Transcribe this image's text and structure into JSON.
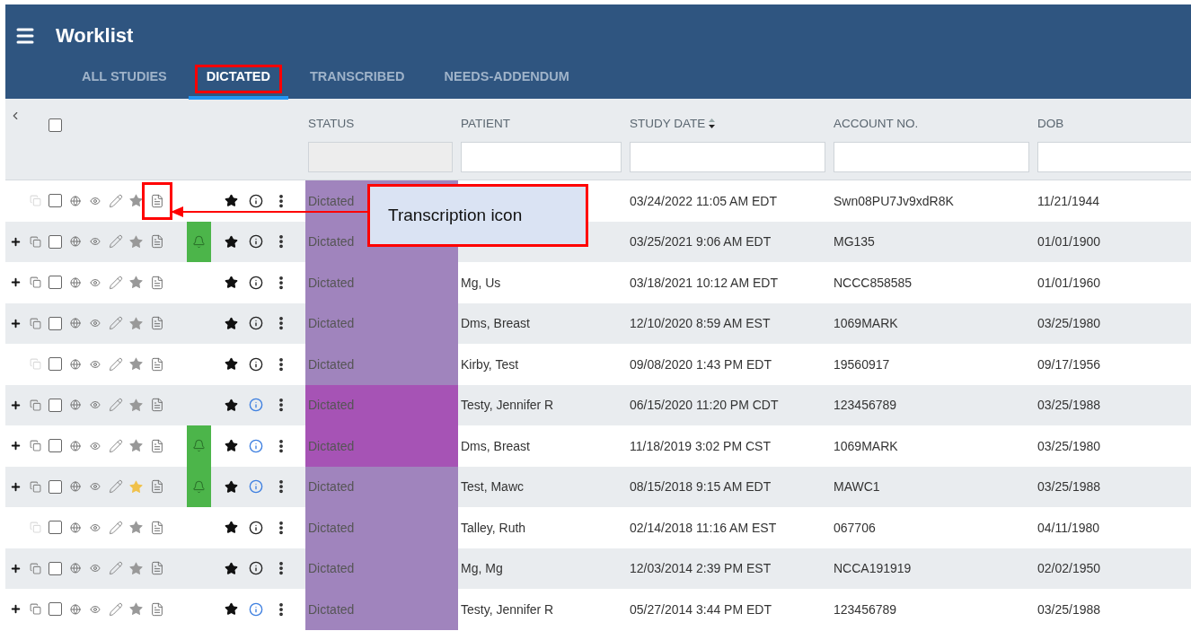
{
  "header": {
    "title": "Worklist"
  },
  "tabs": [
    {
      "label": "ALL STUDIES",
      "selected": false,
      "outlined": false
    },
    {
      "label": "DICTATED",
      "selected": true,
      "outlined": true
    },
    {
      "label": "TRANSCRIBED",
      "selected": false,
      "outlined": false
    },
    {
      "label": "NEEDS-ADDENDUM",
      "selected": false,
      "outlined": false
    }
  ],
  "columns": [
    {
      "label": "STATUS",
      "sortable": false,
      "filter_disabled": true
    },
    {
      "label": "PATIENT",
      "sortable": false,
      "filter_disabled": false
    },
    {
      "label": "STUDY DATE",
      "sortable": true,
      "filter_disabled": false
    },
    {
      "label": "ACCOUNT NO.",
      "sortable": false,
      "filter_disabled": false
    },
    {
      "label": "DOB",
      "sortable": false,
      "filter_disabled": false
    }
  ],
  "select_all": {
    "checked": false
  },
  "rows": [
    {
      "expandable": false,
      "checked": false,
      "starred": false,
      "transcription_outlined": true,
      "alert": false,
      "info_highlighted": false,
      "status": "Dictated",
      "color": "#a084bd",
      "date": "03/24/2022 11:05 AM EDT",
      "account": "Swn08PU7Jv9xdR8K",
      "dob": "11/21/1944"
    },
    {
      "expandable": true,
      "checked": false,
      "starred": false,
      "transcription_outlined": false,
      "alert": true,
      "info_highlighted": false,
      "status": "Dictated",
      "color": "#a084bd",
      "date": "03/25/2021 9:06 AM EDT",
      "account": "MG135",
      "dob": "01/01/1900"
    },
    {
      "expandable": true,
      "checked": false,
      "starred": false,
      "transcription_outlined": false,
      "alert": false,
      "info_highlighted": false,
      "status": "Dictated",
      "color": "#a084bd",
      "patient": "Mg, Us",
      "date": "03/18/2021 10:12 AM EDT",
      "account": "NCCC858585",
      "dob": "01/01/1960"
    },
    {
      "expandable": true,
      "checked": false,
      "starred": false,
      "transcription_outlined": false,
      "alert": false,
      "info_highlighted": false,
      "status": "Dictated",
      "color": "#a084bd",
      "patient": "Dms, Breast",
      "date": "12/10/2020 8:59 AM EST",
      "account": "1069MARK",
      "dob": "03/25/1980"
    },
    {
      "expandable": false,
      "checked": false,
      "starred": false,
      "transcription_outlined": false,
      "alert": false,
      "info_highlighted": false,
      "status": "Dictated",
      "color": "#a084bd",
      "patient": "Kirby, Test",
      "date": "09/08/2020 1:43 PM EDT",
      "account": "19560917",
      "dob": "09/17/1956"
    },
    {
      "expandable": true,
      "checked": false,
      "starred": false,
      "transcription_outlined": false,
      "alert": false,
      "info_highlighted": true,
      "status": "Dictated",
      "color": "#a653b5",
      "patient": "Testy, Jennifer R",
      "date": "06/15/2020 11:20 PM CDT",
      "account": "123456789",
      "dob": "03/25/1988"
    },
    {
      "expandable": true,
      "checked": false,
      "starred": false,
      "transcription_outlined": false,
      "alert": true,
      "info_highlighted": true,
      "status": "Dictated",
      "color": "#a653b5",
      "patient": "Dms, Breast",
      "date": "11/18/2019 3:02 PM CST",
      "account": "1069MARK",
      "dob": "03/25/1980"
    },
    {
      "expandable": true,
      "checked": false,
      "starred": true,
      "transcription_outlined": false,
      "alert": true,
      "info_highlighted": true,
      "status": "Dictated",
      "color": "#a084bd",
      "patient": "Test, Mawc",
      "date": "08/15/2018 9:15 AM EDT",
      "account": "MAWC1",
      "dob": "03/25/1988"
    },
    {
      "expandable": false,
      "checked": false,
      "starred": false,
      "transcription_outlined": false,
      "alert": false,
      "info_highlighted": false,
      "status": "Dictated",
      "color": "#a084bd",
      "patient": "Talley, Ruth",
      "date": "02/14/2018 11:16 AM EST",
      "account": "067706",
      "dob": "04/11/1980"
    },
    {
      "expandable": true,
      "checked": false,
      "starred": false,
      "transcription_outlined": false,
      "alert": false,
      "info_highlighted": false,
      "status": "Dictated",
      "color": "#a084bd",
      "patient": "Mg, Mg",
      "date": "12/03/2014 2:39 PM EST",
      "account": "NCCA191919",
      "dob": "02/02/1950"
    },
    {
      "expandable": true,
      "checked": false,
      "starred": false,
      "transcription_outlined": false,
      "alert": false,
      "info_highlighted": true,
      "status": "Dictated",
      "color": "#a084bd",
      "patient": "Testy, Jennifer R",
      "date": "05/27/2014 3:44 PM EDT",
      "account": "123456789",
      "dob": "03/25/1988"
    }
  ],
  "annotation": {
    "text": "Transcription icon"
  }
}
